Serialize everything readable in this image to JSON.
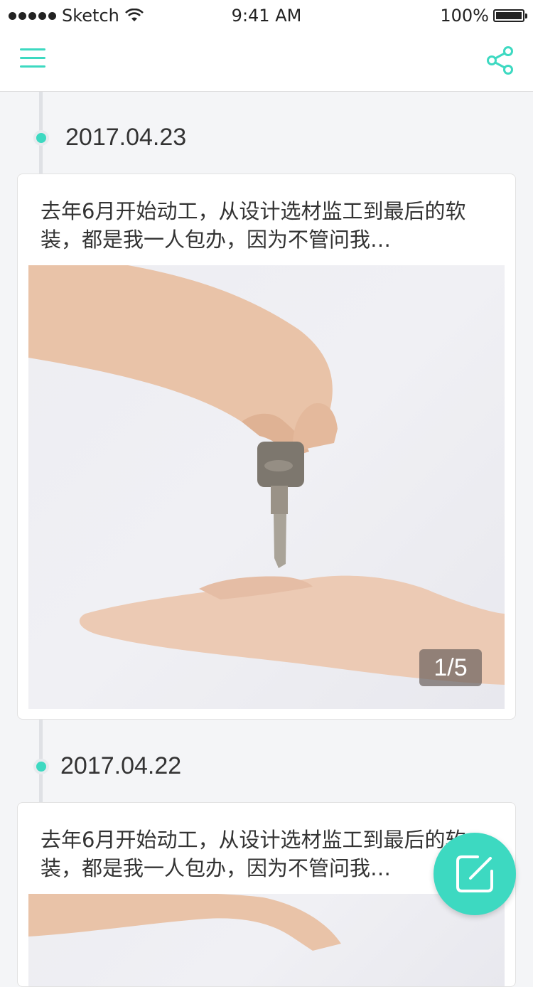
{
  "status_bar": {
    "carrier": "Sketch",
    "time": "9:41 AM",
    "battery": "100%"
  },
  "nav": {
    "left_icon": "menu-icon",
    "right_icon": "share-icon"
  },
  "entries": [
    {
      "date": "2017.04.23",
      "text": "去年6月开始动工，从设计选材监工到最后的软装，都是我一人包办，因为不管问我…",
      "photo_counter": "1/5"
    },
    {
      "date": "2017.04.22",
      "text": "去年6月开始动工，从设计选材监工到最后的软装，都是我一人包办，因为不管问我…"
    }
  ],
  "fab": {
    "icon": "compose-icon"
  },
  "colors": {
    "accent": "#3dd9c1",
    "background": "#f4f5f7"
  }
}
